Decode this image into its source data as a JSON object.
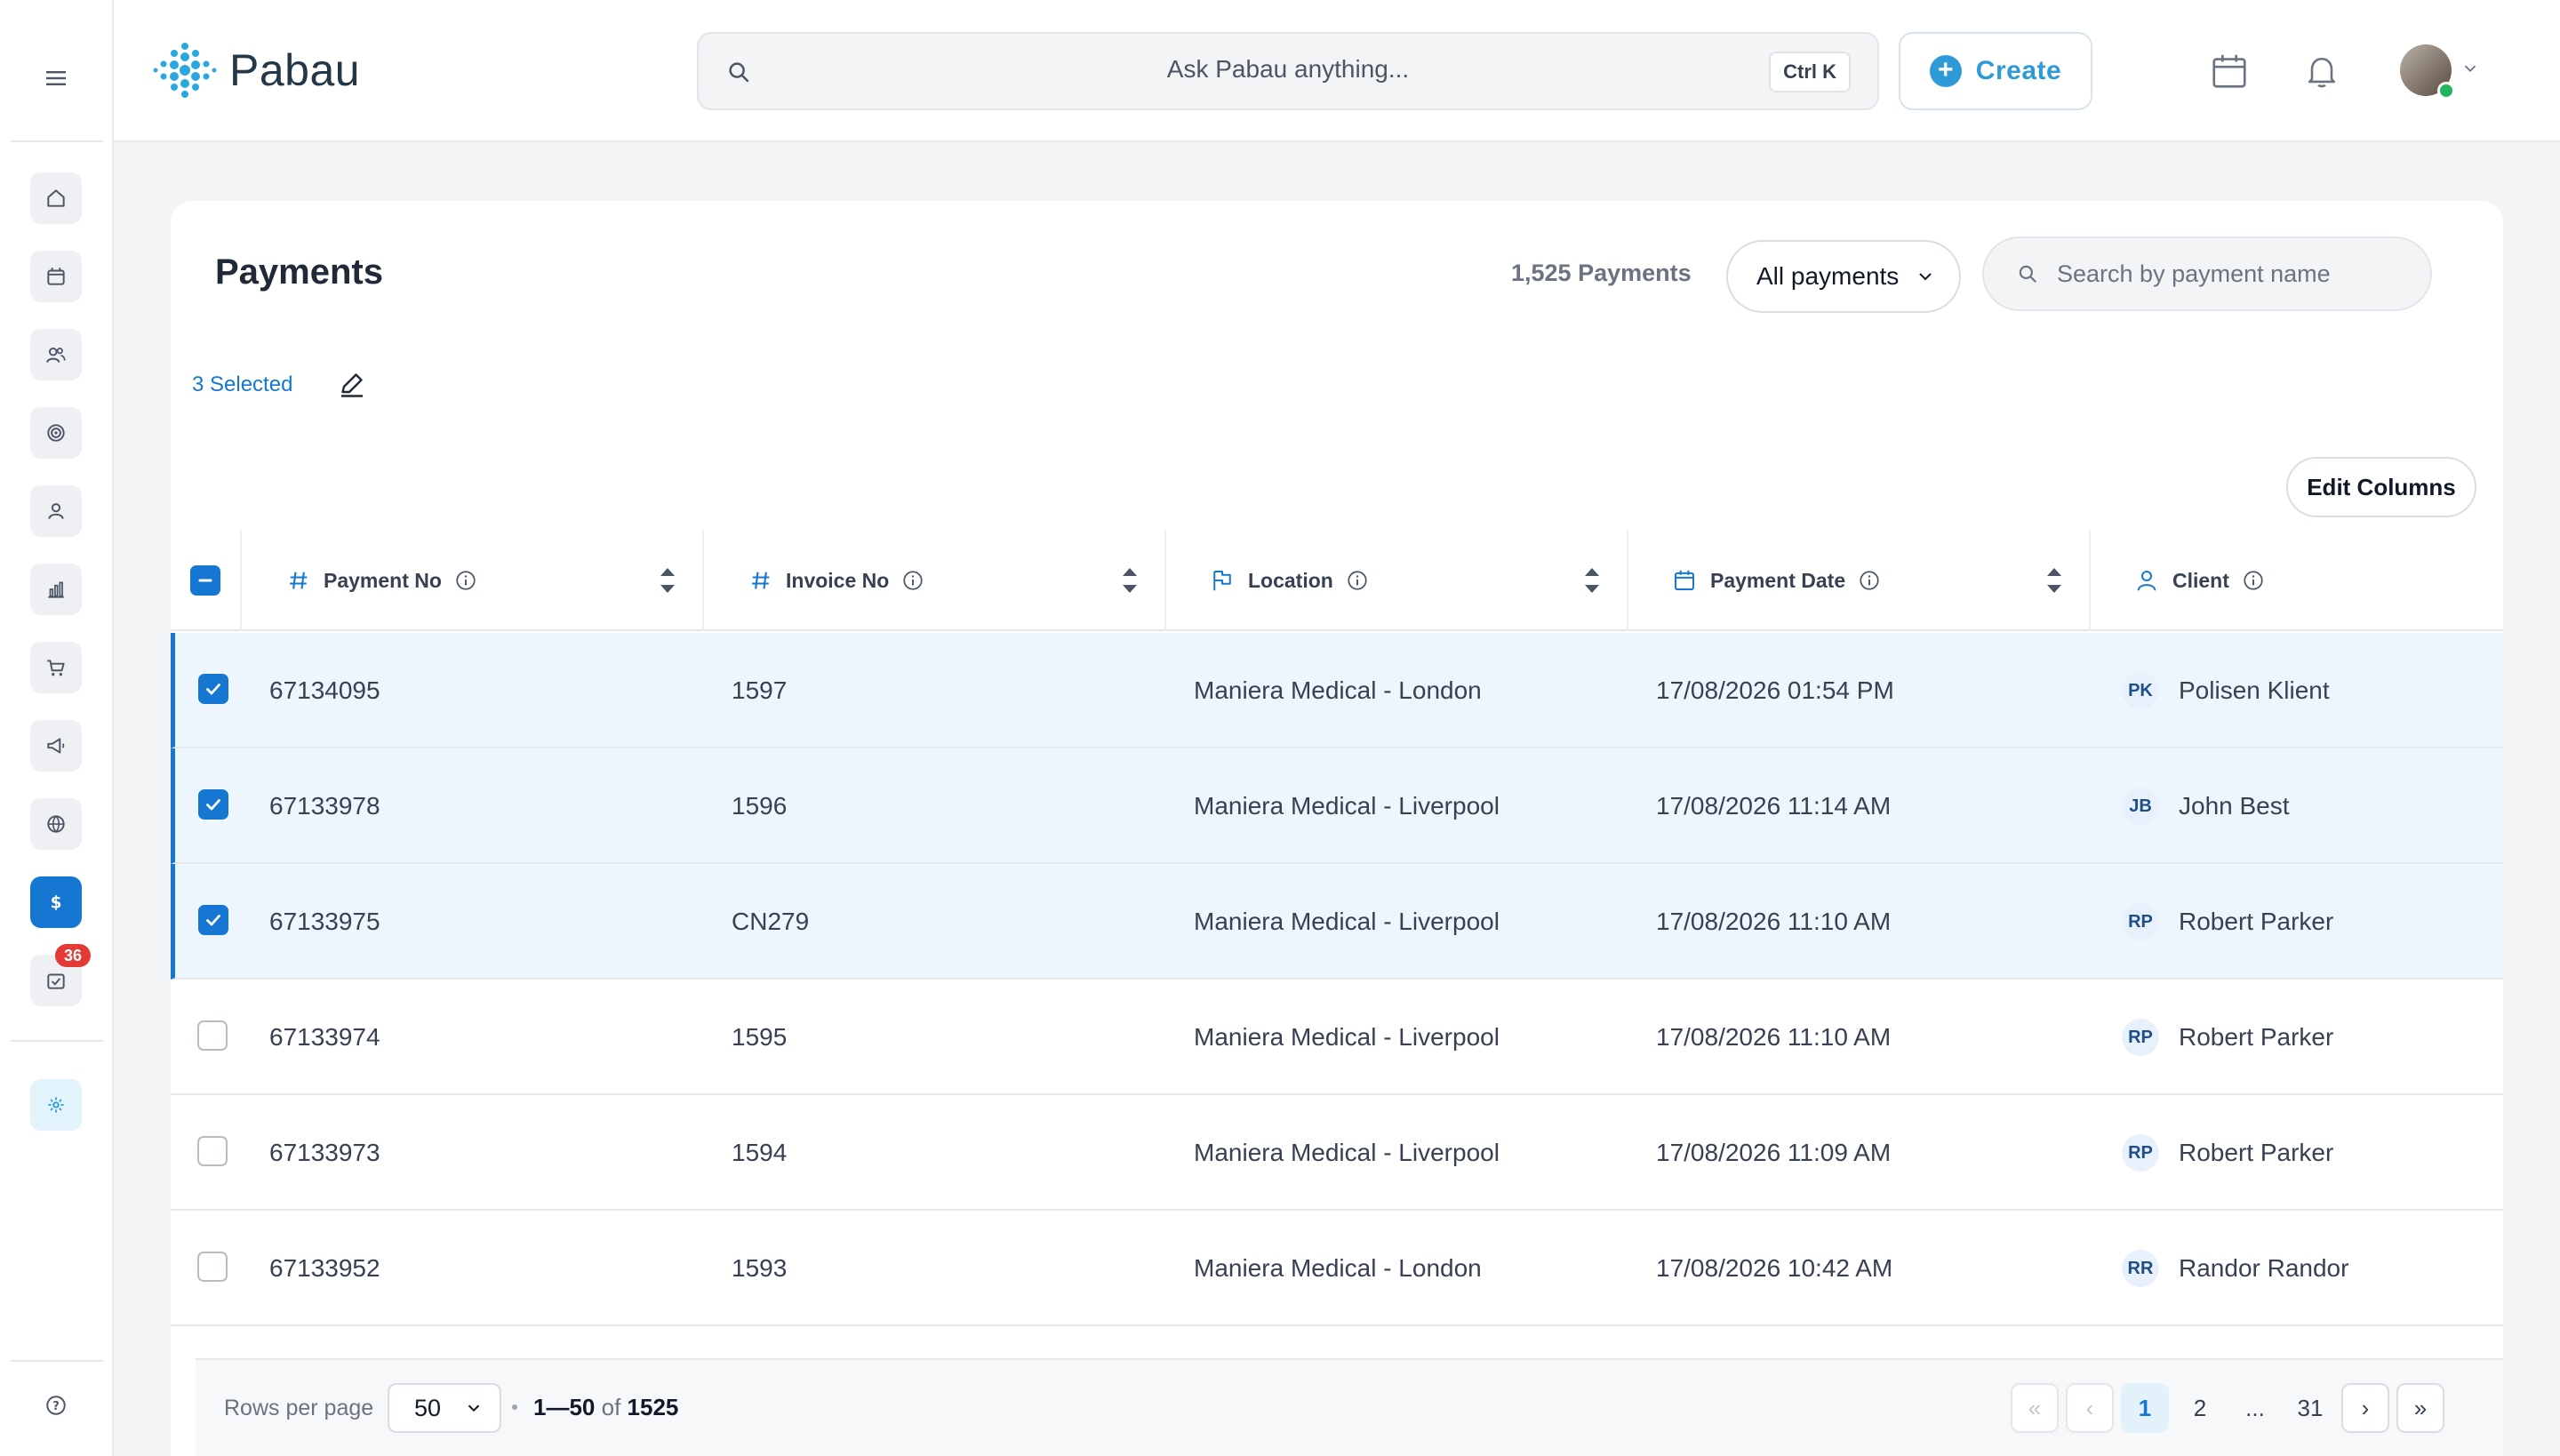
{
  "app": {
    "brand": "Pabau"
  },
  "topbar": {
    "ask_placeholder": "Ask Pabau anything...",
    "shortcut": "Ctrl K",
    "create_label": "Create"
  },
  "sidebar": {
    "items": [
      {
        "name": "home-icon"
      },
      {
        "name": "calendar-icon"
      },
      {
        "name": "people-icon"
      },
      {
        "name": "target-icon"
      },
      {
        "name": "person-icon"
      },
      {
        "name": "bar-chart-icon"
      },
      {
        "name": "cart-icon"
      },
      {
        "name": "megaphone-icon"
      },
      {
        "name": "globe-icon"
      },
      {
        "name": "dollar-icon",
        "active": true
      },
      {
        "name": "tasks-icon",
        "badge": "36"
      },
      {
        "name": "sparkle-icon"
      },
      {
        "name": "help-icon"
      }
    ]
  },
  "payments": {
    "title": "Payments",
    "count_label": "1,525 Payments",
    "filter_label": "All payments",
    "search_placeholder": "Search by payment name",
    "selected_label": "3 Selected",
    "edit_columns_label": "Edit Columns",
    "columns": [
      "Payment No",
      "Invoice No",
      "Location",
      "Payment Date",
      "Client"
    ],
    "rows": [
      {
        "payment_no": "67134095",
        "invoice_no": "1597",
        "location": "Maniera Medical - London",
        "date": "17/08/2026 01:54 PM",
        "initials": "PK",
        "client": "Polisen Klient",
        "selected": true
      },
      {
        "payment_no": "67133978",
        "invoice_no": "1596",
        "location": "Maniera Medical - Liverpool",
        "date": "17/08/2026 11:14 AM",
        "initials": "JB",
        "client": "John Best",
        "selected": true
      },
      {
        "payment_no": "67133975",
        "invoice_no": "CN279",
        "location": "Maniera Medical - Liverpool",
        "date": "17/08/2026 11:10 AM",
        "initials": "RP",
        "client": "Robert Parker",
        "selected": true
      },
      {
        "payment_no": "67133974",
        "invoice_no": "1595",
        "location": "Maniera Medical - Liverpool",
        "date": "17/08/2026 11:10 AM",
        "initials": "RP",
        "client": "Robert Parker",
        "selected": false
      },
      {
        "payment_no": "67133973",
        "invoice_no": "1594",
        "location": "Maniera Medical - Liverpool",
        "date": "17/08/2026 11:09 AM",
        "initials": "RP",
        "client": "Robert Parker",
        "selected": false
      },
      {
        "payment_no": "67133952",
        "invoice_no": "1593",
        "location": "Maniera Medical - London",
        "date": "17/08/2026 10:42 AM",
        "initials": "RR",
        "client": "Randor Randor",
        "selected": false
      }
    ]
  },
  "pagination": {
    "rows_per_page_label": "Rows per page",
    "rows_per_page": "50",
    "range": "1—50",
    "of_label": "of",
    "total": "1525",
    "first": "«",
    "prev": "‹",
    "pages": [
      "1",
      "2",
      "...",
      "31"
    ],
    "current_page": "1",
    "next": "›",
    "last": "»"
  },
  "colors": {
    "accent": "#1677d2",
    "brand": "#2f9bd6",
    "badge": "#e53935"
  }
}
